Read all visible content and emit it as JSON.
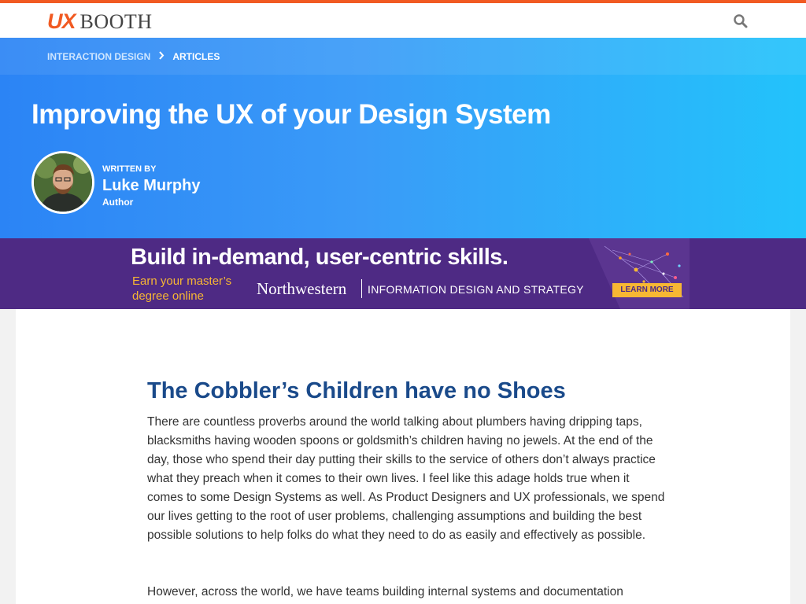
{
  "header": {
    "logo_ux": "UX",
    "logo_booth": "BOOTH",
    "search_icon": "search-icon",
    "accent_color": "#f15a22"
  },
  "hero": {
    "breadcrumb": [
      {
        "label": "INTERACTION DESIGN"
      },
      {
        "label": "ARTICLES"
      }
    ],
    "breadcrumb_separator_icon": "chevron-right-icon",
    "title": "Improving the UX of your Design System",
    "written_by": "WRITTEN BY",
    "author_name": "Luke Murphy",
    "author_role": "Author",
    "gradient_colors": [
      "#2b84f5",
      "#22c3fb"
    ]
  },
  "ad": {
    "headline": "Build in-demand, user-centric skills.",
    "subline": "Earn your master’s degree online",
    "brand": "Northwestern",
    "program": "INFORMATION DESIGN AND STRATEGY",
    "cta": "LEARN MORE",
    "background_color": "#4e2a84",
    "accent_color": "#f7b733"
  },
  "article": {
    "heading": "The Cobbler’s Children have no Shoes",
    "paragraphs": [
      "There are countless proverbs around the world talking about plumbers having dripping taps, blacksmiths having wooden spoons or goldsmith’s children having no jewels. At the end of the day, those who spend their day putting their skills to the service of others don’t always practice what they preach when it comes to their own lives. I feel like this adage holds true when it comes to some Design Systems as well. As Product Designers and UX professionals, we spend our lives getting to the root of user problems, challenging assumptions and building the best possible solutions to help folks do what they need to do as easily and effectively as possible.",
      "However, across the world, we have teams building internal systems and documentation"
    ],
    "heading_color": "#1a4a8a"
  }
}
